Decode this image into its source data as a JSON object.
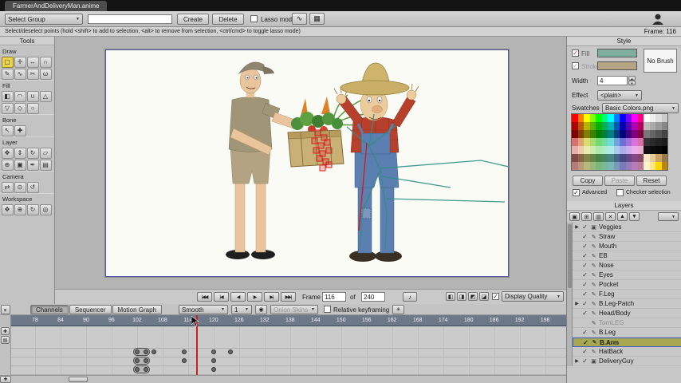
{
  "window": {
    "tab_title": "FarmerAndDeliveryMan.anime"
  },
  "toolbar": {
    "select_group_label": "Select Group",
    "group_filter_value": "",
    "create_label": "Create",
    "delete_label": "Delete",
    "lasso_label": "Lasso mode",
    "icon_buttons": [
      {
        "name": "draw-guides-icon-button",
        "glyph": "∿"
      },
      {
        "name": "stereo-grid-icon-button",
        "glyph": "▦"
      }
    ]
  },
  "hintbar": {
    "hint": "Select/deselect points (hold <shift> to add to selection, <alt> to remove from selection, <ctrl/cmd> to toggle lasso mode)",
    "frame_indicator": "Frame: 116"
  },
  "tools": {
    "title": "Tools",
    "sections": [
      {
        "label": "Draw",
        "tools": [
          {
            "name": "select-points-tool",
            "glyph": "▢",
            "selected": true
          },
          {
            "name": "translate-points-tool",
            "glyph": "✛"
          },
          {
            "name": "scale-points-tool",
            "glyph": "↔"
          },
          {
            "name": "magnet-tool",
            "glyph": "∩"
          },
          {
            "name": "add-point-tool",
            "glyph": "✎"
          },
          {
            "name": "freehand-tool",
            "glyph": "∿"
          },
          {
            "name": "delete-edge-tool",
            "glyph": "✂"
          },
          {
            "name": "curvature-tool",
            "glyph": "ω"
          }
        ]
      },
      {
        "label": "Fill",
        "tools": [
          {
            "name": "select-shape-tool",
            "glyph": "◧"
          },
          {
            "name": "create-shape-tool",
            "glyph": "◠"
          },
          {
            "name": "paint-bucket-tool",
            "glyph": "∪"
          },
          {
            "name": "line-width-tool",
            "glyph": "△"
          },
          {
            "name": "hide-edge-tool",
            "glyph": "▽"
          },
          {
            "name": "stroke-exposure-tool",
            "glyph": "◇"
          },
          {
            "name": "delete-shape-tool",
            "glyph": "○"
          }
        ]
      },
      {
        "label": "Bone",
        "tools": [
          {
            "name": "select-bone-tool",
            "glyph": "↖"
          },
          {
            "name": "add-bone-tool",
            "glyph": "✚"
          }
        ]
      },
      {
        "label": "Layer",
        "tools": [
          {
            "name": "translate-layer-tool",
            "glyph": "✥"
          },
          {
            "name": "scale-layer-tool",
            "glyph": "⇕"
          },
          {
            "name": "rotate-layer-tool",
            "glyph": "↻"
          },
          {
            "name": "shear-layer-tool",
            "glyph": "▱"
          },
          {
            "name": "layer-origin-tool",
            "glyph": "⊕"
          },
          {
            "name": "layer-mask-tool",
            "glyph": "▣"
          },
          {
            "name": "eyedropper-tool",
            "glyph": "✒"
          },
          {
            "name": "crop-layer-tool",
            "glyph": "▤"
          }
        ]
      },
      {
        "label": "Camera",
        "tools": [
          {
            "name": "track-camera-tool",
            "glyph": "⇄"
          },
          {
            "name": "zoom-camera-tool",
            "glyph": "⊙"
          },
          {
            "name": "roll-camera-tool",
            "glyph": "↺"
          }
        ]
      },
      {
        "label": "Workspace",
        "tools": [
          {
            "name": "pan-workspace-tool",
            "glyph": "✥"
          },
          {
            "name": "zoom-workspace-tool",
            "glyph": "⊕"
          },
          {
            "name": "rotate-workspace-tool",
            "glyph": "↻"
          },
          {
            "name": "orbit-workspace-tool",
            "glyph": "◎"
          }
        ]
      }
    ]
  },
  "playback": {
    "buttons": [
      {
        "name": "rewind-button",
        "glyph": "|◀◀"
      },
      {
        "name": "prev-keyframe-button",
        "glyph": "|◀"
      },
      {
        "name": "step-back-button",
        "glyph": "◀"
      },
      {
        "name": "play-button",
        "glyph": "▶"
      },
      {
        "name": "step-forward-button",
        "glyph": "▶|"
      },
      {
        "name": "end-frame-button",
        "glyph": "▶▶|"
      }
    ],
    "frame_label": "Frame",
    "frame_value": "116",
    "of_label": "of",
    "end_frame_value": "240",
    "audio_icon_glyph": "♪",
    "quality_toggles": [
      {
        "name": "quality-toggle-edges",
        "glyph": "◧"
      },
      {
        "name": "quality-toggle-shapes",
        "glyph": "◨"
      },
      {
        "name": "quality-toggle-images",
        "glyph": "◩"
      },
      {
        "name": "quality-toggle-bones",
        "glyph": "◪"
      }
    ],
    "display_quality_label": "Display Quality"
  },
  "timeline": {
    "tabs": [
      {
        "label": "Channels",
        "active": true
      },
      {
        "label": "Sequencer",
        "active": false
      },
      {
        "label": "Motion Graph",
        "active": false
      }
    ],
    "interpolation_value": "Smooth",
    "scale_value": "1",
    "onion_skins_label": "Onion Skins",
    "relative_keyframing_label": "Relative keyframing",
    "ruler_frames": [
      78,
      84,
      90,
      96,
      102,
      108,
      114,
      120,
      126,
      132,
      138,
      144,
      150,
      156,
      162,
      168,
      174,
      180,
      186,
      192,
      198
    ],
    "current_frame": 116,
    "tracks": [
      {
        "row": 0,
        "keys": [
          [
            102,
            104
          ],
          [
            106
          ],
          [
            113
          ],
          [
            120
          ],
          [
            124
          ]
        ]
      },
      {
        "row": 1,
        "keys": [
          [
            102,
            104
          ],
          [
            113
          ],
          [
            120
          ]
        ]
      },
      {
        "row": 2,
        "keys": [
          [
            102,
            104
          ],
          [
            120
          ]
        ]
      }
    ]
  },
  "style_panel": {
    "title": "Style",
    "fill_label": "Fill",
    "fill_color": "#7fae9e",
    "stroke_label": "Stroke",
    "stroke_color": "#b5a585",
    "no_brush_label": "No Brush",
    "width_label": "Width",
    "width_value": "4",
    "effect_label": "Effect",
    "effect_value": "<plain>",
    "swatches_label": "Swatches",
    "swatches_value": "Basic Colors.png",
    "copy_label": "Copy",
    "paste_label": "Paste",
    "reset_label": "Reset",
    "advanced_label": "Advanced",
    "checker_label": "Checker selection",
    "palette": [
      [
        "#ff0000",
        "#ff8000",
        "#ffff00",
        "#80ff00",
        "#00ff00",
        "#00ff80",
        "#00ffff",
        "#0080ff",
        "#0000ff",
        "#8000ff",
        "#ff00ff",
        "#ff0080",
        "#ffffff",
        "#eeeeee",
        "#dddddd",
        "#cccccc"
      ],
      [
        "#b30000",
        "#b35900",
        "#b3b300",
        "#59b300",
        "#00b300",
        "#00b359",
        "#00b3b3",
        "#0059b3",
        "#0000b3",
        "#5900b3",
        "#b300b3",
        "#b30059",
        "#bbbbbb",
        "#aaaaaa",
        "#999999",
        "#888888"
      ],
      [
        "#800000",
        "#804000",
        "#808000",
        "#408000",
        "#008000",
        "#008040",
        "#008080",
        "#004080",
        "#000080",
        "#400080",
        "#800080",
        "#800040",
        "#777777",
        "#666666",
        "#555555",
        "#444444"
      ],
      [
        "#db7070",
        "#dba670",
        "#dbdb70",
        "#a6db70",
        "#70db70",
        "#70dba6",
        "#70dbdb",
        "#70a6db",
        "#7070db",
        "#a670db",
        "#db70db",
        "#db70a6",
        "#333333",
        "#2a2a2a",
        "#222222",
        "#1a1a1a"
      ],
      [
        "#ebadad",
        "#ebccad",
        "#ebebad",
        "#ccebad",
        "#adebad",
        "#adebcc",
        "#adebeb",
        "#adcceb",
        "#adadeb",
        "#ccadeb",
        "#ebadeb",
        "#ebadcc",
        "#111111",
        "#0d0d0d",
        "#080808",
        "#000000"
      ],
      [
        "#854747",
        "#856647",
        "#858547",
        "#668547",
        "#478547",
        "#478566",
        "#478585",
        "#476685",
        "#474785",
        "#664785",
        "#854785",
        "#854766",
        "#f5e6c8",
        "#e6cc99",
        "#cca366",
        "#997a4d"
      ],
      [
        "#b87a7a",
        "#b8997a",
        "#b8b87a",
        "#99b87a",
        "#7ab87a",
        "#7ab899",
        "#7ab8b8",
        "#7a99b8",
        "#7a7ab8",
        "#997ab8",
        "#b87ab8",
        "#b87a99",
        "#fff2cc",
        "#ffe680",
        "#ffd700",
        "#b8860b"
      ]
    ]
  },
  "layers_panel": {
    "title": "Layers",
    "toolbar_icons": [
      {
        "name": "new-layer-icon",
        "glyph": "▣"
      },
      {
        "name": "new-group-icon",
        "glyph": "⊞"
      },
      {
        "name": "duplicate-layer-icon",
        "glyph": "▥"
      },
      {
        "name": "delete-layer-icon",
        "glyph": "✕"
      },
      {
        "name": "raise-layer-icon",
        "glyph": "▲"
      },
      {
        "name": "lower-layer-icon",
        "glyph": "▼"
      }
    ],
    "rows": [
      {
        "name": "Veggies",
        "expand": true,
        "type": "group"
      },
      {
        "name": "Straw"
      },
      {
        "name": "Mouth"
      },
      {
        "name": "EB"
      },
      {
        "name": "Nose"
      },
      {
        "name": "Eyes"
      },
      {
        "name": "Pocket"
      },
      {
        "name": "F.Leg"
      },
      {
        "name": "B.Leg-Patch",
        "expand": true
      },
      {
        "name": "Head/Body"
      },
      {
        "name": "TornLEG",
        "dimmed": true,
        "visible": false
      },
      {
        "name": "B.Leg"
      },
      {
        "name": "B.Arm",
        "selected": true
      },
      {
        "name": "HatBack"
      },
      {
        "name": "DeliveryGuy",
        "expand": true,
        "type": "group"
      }
    ]
  }
}
